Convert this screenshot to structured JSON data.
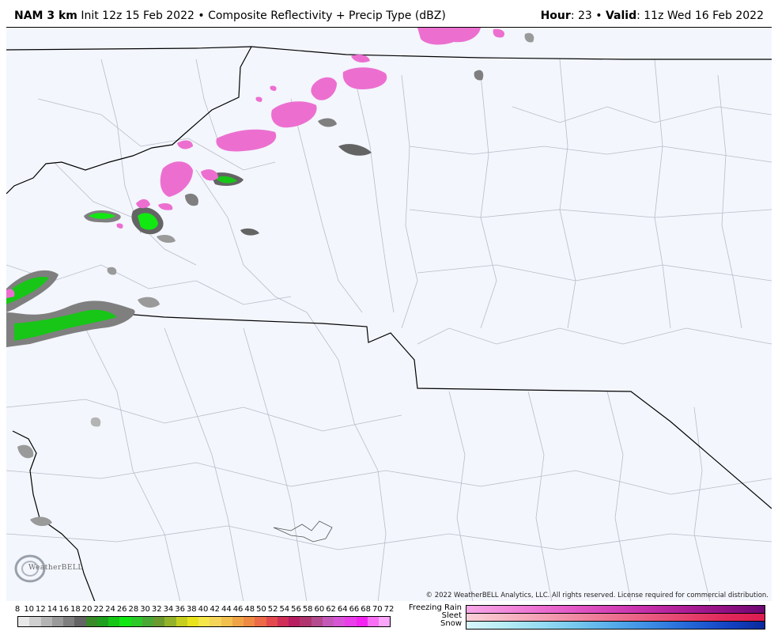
{
  "header": {
    "model": "NAM 3 km",
    "init": "Init 12z 15 Feb 2022",
    "separator": "•",
    "product": "Composite Reflectivity + Precip Type (dBZ)",
    "hour_label": "Hour",
    "hour_value": ": 23",
    "valid_label": "Valid",
    "valid_value": ": 11z Wed 16 Feb 2022"
  },
  "map": {
    "background_color": "#f3f6fd",
    "copyright": "© 2022 WeatherBELL Analytics, LLC. All rights reserved. License required for commercial distribution.",
    "logo_text": "WeatherBELL"
  },
  "legend": {
    "dbz_ticks": [
      "8",
      "10",
      "12",
      "14",
      "16",
      "18",
      "20",
      "22",
      "24",
      "26",
      "28",
      "30",
      "32",
      "34",
      "36",
      "38",
      "40",
      "42",
      "44",
      "46",
      "48",
      "50",
      "52",
      "54",
      "56",
      "58",
      "60",
      "62",
      "64",
      "66",
      "68",
      "70",
      "72"
    ],
    "dbz_colors": [
      "#e8e8e8",
      "#cfcfcf",
      "#b4b4b4",
      "#9a9a9a",
      "#7f7f7f",
      "#646464",
      "#3a8a2a",
      "#1fa01f",
      "#17c617",
      "#11e811",
      "#2ec82a",
      "#4aa836",
      "#6b9b2e",
      "#93b22a",
      "#c5cf20",
      "#e8e31c",
      "#f5e64a",
      "#f4d55a",
      "#f2c04e",
      "#f0a447",
      "#ee8a44",
      "#ec6a48",
      "#e34a50",
      "#cf2f58",
      "#b81e62",
      "#b0356e",
      "#b34b8e",
      "#c45ab8",
      "#d856d6",
      "#ea3ee8",
      "#f324f0",
      "#f86ff5",
      "#fba6f8"
    ],
    "ptypes": [
      {
        "name": "Freezing Rain",
        "colors": [
          "#f6a8e8",
          "#f28cdc",
          "#ec6fd0",
          "#e256c4",
          "#d440b6",
          "#c22ca6",
          "#ab1c94",
          "#901082",
          "#6e0872"
        ]
      },
      {
        "name": "Sleet",
        "colors": [
          "#fbd0d8",
          "#f8b8c6",
          "#f4a0b4",
          "#f088a2",
          "#ec7090",
          "#e8587e",
          "#e4406c",
          "#e0285a",
          "#dc1c50"
        ]
      },
      {
        "name": "Snow",
        "colors": [
          "#d8f6fa",
          "#b8ecf6",
          "#96dcf2",
          "#74c6ee",
          "#54aaea",
          "#3a8ae4",
          "#2466d8",
          "#1444c4",
          "#0a2a9c"
        ]
      }
    ]
  }
}
